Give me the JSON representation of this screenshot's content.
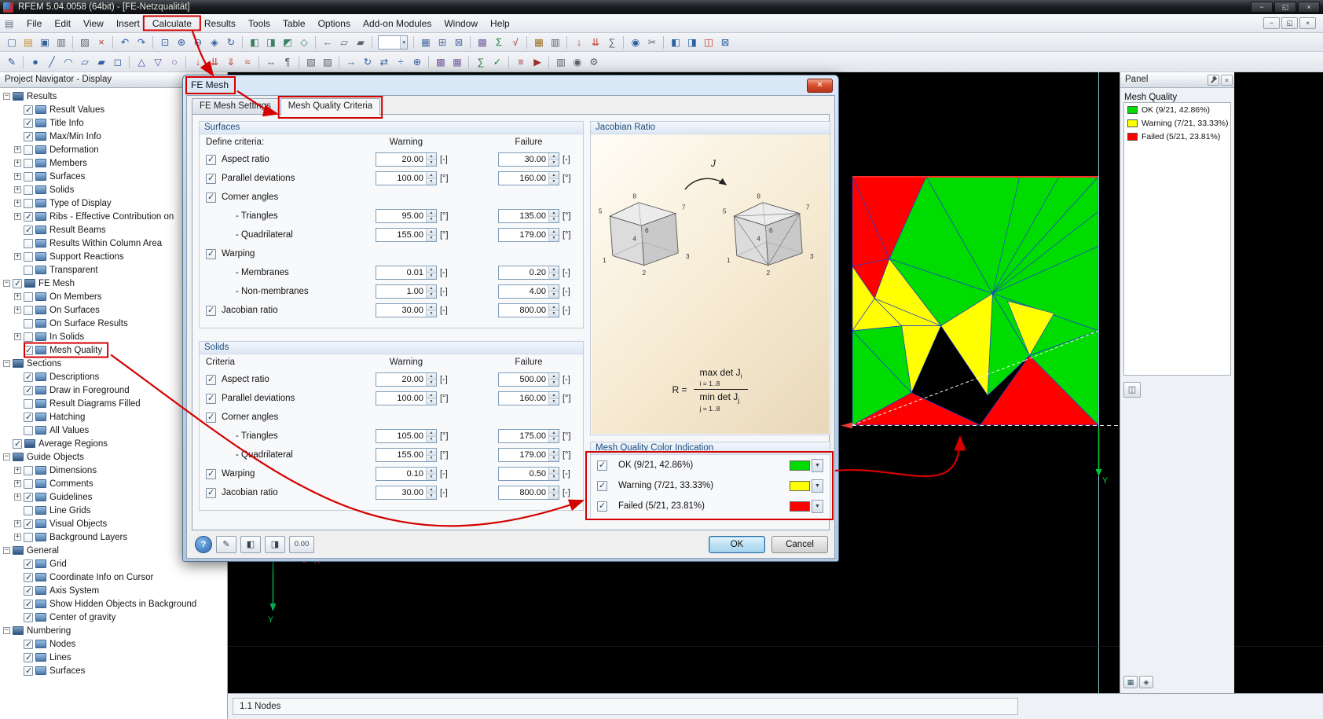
{
  "window": {
    "title": "RFEM 5.04.0058 (64bit) - [FE-Netzqualität]",
    "menu": [
      "File",
      "Edit",
      "View",
      "Insert",
      "Calculate",
      "Results",
      "Tools",
      "Table",
      "Options",
      "Add-on Modules",
      "Window",
      "Help"
    ]
  },
  "toolbars": {
    "row1": [
      {
        "name": "new-model",
        "glyph": "▢",
        "color": "#4a6f9e"
      },
      {
        "name": "open-project",
        "glyph": "▤",
        "color": "#c2922e"
      },
      {
        "name": "save",
        "glyph": "▣",
        "color": "#33629b"
      },
      {
        "name": "print",
        "glyph": "▥",
        "color": "#5a6068"
      },
      {
        "sep": true
      },
      {
        "name": "copy",
        "glyph": "▨",
        "color": "#5a6068"
      },
      {
        "name": "delete",
        "glyph": "×",
        "color": "#b03a2e"
      },
      {
        "sep": true
      },
      {
        "name": "undo",
        "glyph": "↶",
        "color": "#2e5fa3"
      },
      {
        "name": "redo",
        "glyph": "↷",
        "color": "#2e5fa3"
      },
      {
        "sep": true
      },
      {
        "name": "zoom-window",
        "glyph": "⊡",
        "color": "#2e5fa3"
      },
      {
        "name": "zoom-in",
        "glyph": "⊕",
        "color": "#2e5fa3"
      },
      {
        "name": "zoom-out",
        "glyph": "⊖",
        "color": "#2e5fa3"
      },
      {
        "name": "move-view",
        "glyph": "◈",
        "color": "#2e5fa3"
      },
      {
        "name": "rotate-view",
        "glyph": "↻",
        "color": "#2e5fa3"
      },
      {
        "sep": true
      },
      {
        "name": "view-in-x",
        "glyph": "◧",
        "color": "#3f7f66"
      },
      {
        "name": "view-in-y",
        "glyph": "◨",
        "color": "#3f7f66"
      },
      {
        "name": "view-in-z",
        "glyph": "◩",
        "color": "#3f7f66"
      },
      {
        "name": "isometric-view",
        "glyph": "◇",
        "color": "#3f7f66"
      },
      {
        "sep": true
      },
      {
        "name": "previous-view",
        "glyph": "←",
        "color": "#5a6068"
      },
      {
        "name": "wireframe-display",
        "glyph": "▱",
        "color": "#5a6068"
      },
      {
        "name": "solid-display",
        "glyph": "▰",
        "color": "#5a6068"
      },
      {
        "sep": true
      },
      {
        "combo": true,
        "name": "view-selector"
      },
      {
        "sep": true
      },
      {
        "name": "show-grid",
        "glyph": "▦",
        "color": "#4a6f9e"
      },
      {
        "name": "snap-to-grid",
        "glyph": "⊞",
        "color": "#4a6f9e"
      },
      {
        "name": "work-plane",
        "glyph": "⊠",
        "color": "#4a6f9e"
      },
      {
        "sep": true
      },
      {
        "name": "generate-mesh",
        "glyph": "▩",
        "color": "#7a5fa0"
      },
      {
        "name": "calculate-all",
        "glyph": "Σ",
        "color": "#1f7a33"
      },
      {
        "name": "show-results",
        "glyph": "√",
        "color": "#9a2f2f"
      },
      {
        "sep": true
      },
      {
        "name": "tables",
        "glyph": "▦",
        "color": "#9a6f1f"
      },
      {
        "name": "printout-report",
        "glyph": "▥",
        "color": "#5a6068"
      },
      {
        "sep": true
      },
      {
        "name": "new-load-case",
        "glyph": "↓",
        "color": "#c0392b"
      },
      {
        "name": "load-cases",
        "glyph": "⇊",
        "color": "#c0392b"
      },
      {
        "name": "combinations",
        "glyph": "∑",
        "color": "#5a6068"
      },
      {
        "sep": true
      },
      {
        "name": "visibilities",
        "glyph": "◉",
        "color": "#2e5fa3"
      },
      {
        "name": "section-cut",
        "glyph": "✂",
        "color": "#5a6068"
      },
      {
        "sep": true
      },
      {
        "name": "toggle-navigator",
        "glyph": "◧",
        "color": "#2e5fa3"
      },
      {
        "name": "toggle-tables",
        "glyph": "◨",
        "color": "#2e5fa3"
      },
      {
        "name": "toggle-panel",
        "glyph": "◫",
        "color": "#c0392b"
      },
      {
        "name": "fullscreen",
        "glyph": "⊠",
        "color": "#2e5fa3"
      }
    ],
    "row2": [
      {
        "name": "edit",
        "glyph": "✎",
        "color": "#2e5fa3"
      },
      {
        "sep": true
      },
      {
        "name": "node",
        "glyph": "●",
        "color": "#2e5fa3"
      },
      {
        "name": "line",
        "glyph": "╱",
        "color": "#2e5fa3"
      },
      {
        "name": "arc",
        "glyph": "◠",
        "color": "#2e5fa3"
      },
      {
        "name": "surface",
        "glyph": "▱",
        "color": "#2e5fa3"
      },
      {
        "name": "solid",
        "glyph": "▰",
        "color": "#2e5fa3"
      },
      {
        "name": "opening",
        "glyph": "◻",
        "color": "#2e5fa3"
      },
      {
        "sep": true
      },
      {
        "name": "nodal-support",
        "glyph": "△",
        "color": "#6b3fa0"
      },
      {
        "name": "line-support",
        "glyph": "▽",
        "color": "#6b3fa0"
      },
      {
        "name": "member-hinge",
        "glyph": "○",
        "color": "#6b3fa0"
      },
      {
        "sep": true
      },
      {
        "name": "nodal-load",
        "glyph": "↓",
        "color": "#c0392b"
      },
      {
        "name": "member-load",
        "glyph": "⇊",
        "color": "#c0392b"
      },
      {
        "name": "surface-load",
        "glyph": "⇓",
        "color": "#c0392b"
      },
      {
        "name": "imperfection",
        "glyph": "≈",
        "color": "#c0392b"
      },
      {
        "sep": true
      },
      {
        "name": "dimension",
        "glyph": "↔",
        "color": "#5a6068"
      },
      {
        "name": "comment",
        "glyph": "¶",
        "color": "#5a6068"
      },
      {
        "sep": true
      },
      {
        "name": "select-all",
        "glyph": "▧",
        "color": "#5a6068"
      },
      {
        "name": "select-special",
        "glyph": "▨",
        "color": "#5a6068"
      },
      {
        "sep": true
      },
      {
        "name": "move-copy",
        "glyph": "→",
        "color": "#2e5fa3"
      },
      {
        "name": "rotate-copy",
        "glyph": "↻",
        "color": "#2e5fa3"
      },
      {
        "name": "mirror",
        "glyph": "⇄",
        "color": "#2e5fa3"
      },
      {
        "name": "divide",
        "glyph": "÷",
        "color": "#2e5fa3"
      },
      {
        "name": "connect",
        "glyph": "⊕",
        "color": "#2e5fa3"
      },
      {
        "sep": true
      },
      {
        "name": "mesh-settings",
        "glyph": "▩",
        "color": "#7a5fa0"
      },
      {
        "name": "mesh-refinement",
        "glyph": "▦",
        "color": "#7a5fa0"
      },
      {
        "sep": true
      },
      {
        "name": "calculation-parameters",
        "glyph": "∑",
        "color": "#1f7a33"
      },
      {
        "name": "check-model",
        "glyph": "✓",
        "color": "#1f7a33"
      },
      {
        "sep": true
      },
      {
        "name": "result-diagrams",
        "glyph": "≡",
        "color": "#9a2f2f"
      },
      {
        "name": "animate-results",
        "glyph": "▶",
        "color": "#9a2f2f"
      },
      {
        "sep": true
      },
      {
        "name": "report",
        "glyph": "▥",
        "color": "#5a6068"
      },
      {
        "name": "screenshot",
        "glyph": "◉",
        "color": "#5a6068"
      },
      {
        "name": "settings",
        "glyph": "⚙",
        "color": "#5a6068"
      }
    ]
  },
  "navigator": {
    "title": "Project Navigator - Display",
    "tree": [
      [
        "Results",
        0,
        "-",
        null
      ],
      [
        "Result Values",
        1,
        null,
        true
      ],
      [
        "Title Info",
        1,
        null,
        true
      ],
      [
        "Max/Min Info",
        1,
        null,
        true
      ],
      [
        "Deformation",
        1,
        "+",
        false
      ],
      [
        "Members",
        1,
        "+",
        false
      ],
      [
        "Surfaces",
        1,
        "+",
        false
      ],
      [
        "Solids",
        1,
        "+",
        false
      ],
      [
        "Type of Display",
        1,
        "+",
        false
      ],
      [
        "Ribs - Effective Contribution on",
        1,
        "+",
        true
      ],
      [
        "Result Beams",
        1,
        null,
        true
      ],
      [
        "Results Within Column Area",
        1,
        null,
        false
      ],
      [
        "Support Reactions",
        1,
        "+",
        false
      ],
      [
        "Transparent",
        1,
        null,
        false
      ],
      [
        "FE Mesh",
        0,
        "-",
        true
      ],
      [
        "On Members",
        1,
        "+",
        false
      ],
      [
        "On Surfaces",
        1,
        "+",
        false
      ],
      [
        "On Surface Results",
        1,
        null,
        false
      ],
      [
        "In Solids",
        1,
        "+",
        false
      ],
      [
        "Mesh Quality",
        1,
        null,
        true
      ],
      [
        "Sections",
        0,
        "-",
        null
      ],
      [
        "Descriptions",
        1,
        null,
        true
      ],
      [
        "Draw in Foreground",
        1,
        null,
        true
      ],
      [
        "Result Diagrams Filled",
        1,
        null,
        false
      ],
      [
        "Hatching",
        1,
        null,
        true
      ],
      [
        "All Values",
        1,
        null,
        false
      ],
      [
        "Average Regions",
        0,
        null,
        true
      ],
      [
        "Guide Objects",
        0,
        "-",
        null
      ],
      [
        "Dimensions",
        1,
        "+",
        false
      ],
      [
        "Comments",
        1,
        "+",
        false
      ],
      [
        "Guidelines",
        1,
        "+",
        true
      ],
      [
        "Line Grids",
        1,
        null,
        false
      ],
      [
        "Visual Objects",
        1,
        "+",
        true
      ],
      [
        "Background Layers",
        1,
        "+",
        false
      ],
      [
        "General",
        0,
        "-",
        null
      ],
      [
        "Grid",
        1,
        null,
        true
      ],
      [
        "Coordinate Info on Cursor",
        1,
        null,
        true
      ],
      [
        "Axis System",
        1,
        null,
        true
      ],
      [
        "Show Hidden Objects in Background",
        1,
        null,
        true
      ],
      [
        "Center of gravity",
        1,
        null,
        true
      ],
      [
        "Numbering",
        0,
        "-",
        null
      ],
      [
        "Nodes",
        1,
        null,
        true
      ],
      [
        "Lines",
        1,
        null,
        true
      ],
      [
        "Surfaces",
        1,
        null,
        true
      ]
    ]
  },
  "dialog": {
    "title": "FE Mesh",
    "tabs": [
      "FE Mesh Settings",
      "Mesh Quality Criteria"
    ],
    "surfaces": {
      "title": "Surfaces",
      "columns": {
        "criteria": "Define criteria:",
        "warning": "Warning",
        "failure": "Failure"
      },
      "rows": [
        {
          "label": "Aspect ratio",
          "checked": true,
          "warning": "20.00",
          "warning_unit": "[-]",
          "failure": "30.00",
          "failure_unit": "[-]"
        },
        {
          "label": "Parallel deviations",
          "checked": true,
          "warning": "100.00",
          "warning_unit": "[°]",
          "failure": "160.00",
          "failure_unit": "[°]"
        },
        {
          "label": "Corner angles",
          "checked": true
        },
        {
          "label": "- Triangles",
          "sub": true,
          "warning": "95.00",
          "warning_unit": "[°]",
          "failure": "135.00",
          "failure_unit": "[°]"
        },
        {
          "label": "- Quadrilateral",
          "sub": true,
          "warning": "155.00",
          "warning_unit": "[°]",
          "failure": "179.00",
          "failure_unit": "[°]"
        },
        {
          "label": "Warping",
          "checked": true
        },
        {
          "label": "- Membranes",
          "sub": true,
          "warning": "0.01",
          "warning_unit": "[-]",
          "failure": "0.20",
          "failure_unit": "[-]"
        },
        {
          "label": "- Non-membranes",
          "sub": true,
          "warning": "1.00",
          "warning_unit": "[-]",
          "failure": "4.00",
          "failure_unit": "[-]"
        },
        {
          "label": "Jacobian ratio",
          "checked": true,
          "warning": "30.00",
          "warning_unit": "[-]",
          "failure": "800.00",
          "failure_unit": "[-]"
        }
      ]
    },
    "solids": {
      "title": "Solids",
      "columns": {
        "criteria": "Criteria",
        "warning": "Warning",
        "failure": "Failure"
      },
      "rows": [
        {
          "label": "Aspect ratio",
          "checked": true,
          "warning": "20.00",
          "warning_unit": "[-]",
          "failure": "500.00",
          "failure_unit": "[-]"
        },
        {
          "label": "Parallel deviations",
          "checked": true,
          "warning": "100.00",
          "warning_unit": "[°]",
          "failure": "160.00",
          "failure_unit": "[°]"
        },
        {
          "label": "Corner angles",
          "checked": true
        },
        {
          "label": "- Triangles",
          "sub": true,
          "warning": "105.00",
          "warning_unit": "[°]",
          "failure": "175.00",
          "failure_unit": "[°]"
        },
        {
          "label": "- Quadrilateral",
          "sub": true,
          "warning": "155.00",
          "warning_unit": "[°]",
          "failure": "179.00",
          "failure_unit": "[°]"
        },
        {
          "label": "Warping",
          "checked": true,
          "warning": "0.10",
          "warning_unit": "[-]",
          "failure": "0.50",
          "failure_unit": "[-]"
        },
        {
          "label": "Jacobian ratio",
          "checked": true,
          "warning": "30.00",
          "warning_unit": "[-]",
          "failure": "800.00",
          "failure_unit": "[-]"
        }
      ]
    },
    "jacobian": {
      "title": "Jacobian Ratio",
      "vertex_labels": [
        "1",
        "2",
        "3",
        "4",
        "5",
        "6",
        "7",
        "8"
      ],
      "arrow_label": "J",
      "formula": {
        "lhs": "R =",
        "numerator": "max det J",
        "numerator_sub": "i",
        "numerator_range": "i = 1..8",
        "denominator": "min det J",
        "denominator_sub": "j",
        "denominator_range": "j = 1..8"
      }
    },
    "color_indication": {
      "title": "Mesh Quality Color Indication",
      "items": [
        {
          "label": "OK (9/21, 42.86%)",
          "checked": true,
          "color": "#00dc00"
        },
        {
          "label": "Warning (7/21, 33.33%)",
          "checked": true,
          "color": "#ffff00"
        },
        {
          "label": "Failed (5/21, 23.81%)",
          "checked": true,
          "color": "#ff0000"
        }
      ]
    },
    "buttons": {
      "ok": "OK",
      "cancel": "Cancel",
      "units": "0.00"
    }
  },
  "panel": {
    "title": "Panel",
    "section": "Mesh Quality",
    "legend": [
      {
        "label": "OK (9/21, 42.86%)",
        "color": "#00dc00"
      },
      {
        "label": "Warning (7/21, 33.33%)",
        "color": "#ffff00"
      },
      {
        "label": "Failed (5/21, 23.81%)",
        "color": "#ff0000"
      }
    ]
  },
  "statusbar": {
    "text": "1.1 Nodes"
  },
  "viewport": {
    "axes": {
      "x_label": "X",
      "y_label": "Y"
    },
    "mesh_axis_label": "Y",
    "mesh": {
      "colors": {
        "ok": "#00dc00",
        "warning": "#ffff00",
        "failed": "#ff0000"
      },
      "triangles": [
        {
          "c": "ok",
          "p": "30,0 100,0 57,47"
        },
        {
          "c": "ok",
          "p": "15,33 30,0 57,47"
        },
        {
          "c": "ok",
          "p": "100,0 100,62 57,47"
        },
        {
          "c": "ok",
          "p": "57,47 100,62 72,72"
        },
        {
          "c": "ok",
          "p": "57,47 72,72 55,88"
        },
        {
          "c": "ok",
          "p": "0,62 20,60 24,87"
        },
        {
          "c": "ok",
          "p": "0,62 24,87 0,100"
        },
        {
          "c": "ok",
          "p": "15,33 57,47 36,60"
        },
        {
          "c": "ok",
          "p": "72,72 100,62 100,100"
        },
        {
          "c": "warning",
          "p": "0,36 9,49 0,62"
        },
        {
          "c": "warning",
          "p": "9,49 20,60 0,62"
        },
        {
          "c": "warning",
          "p": "9,49 15,33 36,60"
        },
        {
          "c": "warning",
          "p": "9,49 36,60 20,60"
        },
        {
          "c": "warning",
          "p": "36,60 57,47 55,88"
        },
        {
          "c": "warning",
          "p": "63,50 82,55 72,72"
        },
        {
          "c": "warning",
          "p": "20,60 36,60 24,87"
        },
        {
          "c": "failed",
          "p": "0,0 30,0 15,33"
        },
        {
          "c": "failed",
          "p": "0,0 15,33 0,36"
        },
        {
          "c": "failed",
          "p": "0,36 15,33 9,49"
        },
        {
          "c": "failed",
          "p": "0,100 24,87 52,100"
        },
        {
          "c": "failed",
          "p": "52,100 72,72 100,100"
        }
      ],
      "edge_lines": [
        {
          "p": "68,0 57,47"
        },
        {
          "p": "84,0 57,47"
        },
        {
          "p": "100,28 57,47"
        },
        {
          "p": "100,14 57,47"
        }
      ],
      "dashed_lines": [
        {
          "p": "0,100 70,74"
        },
        {
          "p": "70,74 100,62"
        }
      ]
    }
  }
}
